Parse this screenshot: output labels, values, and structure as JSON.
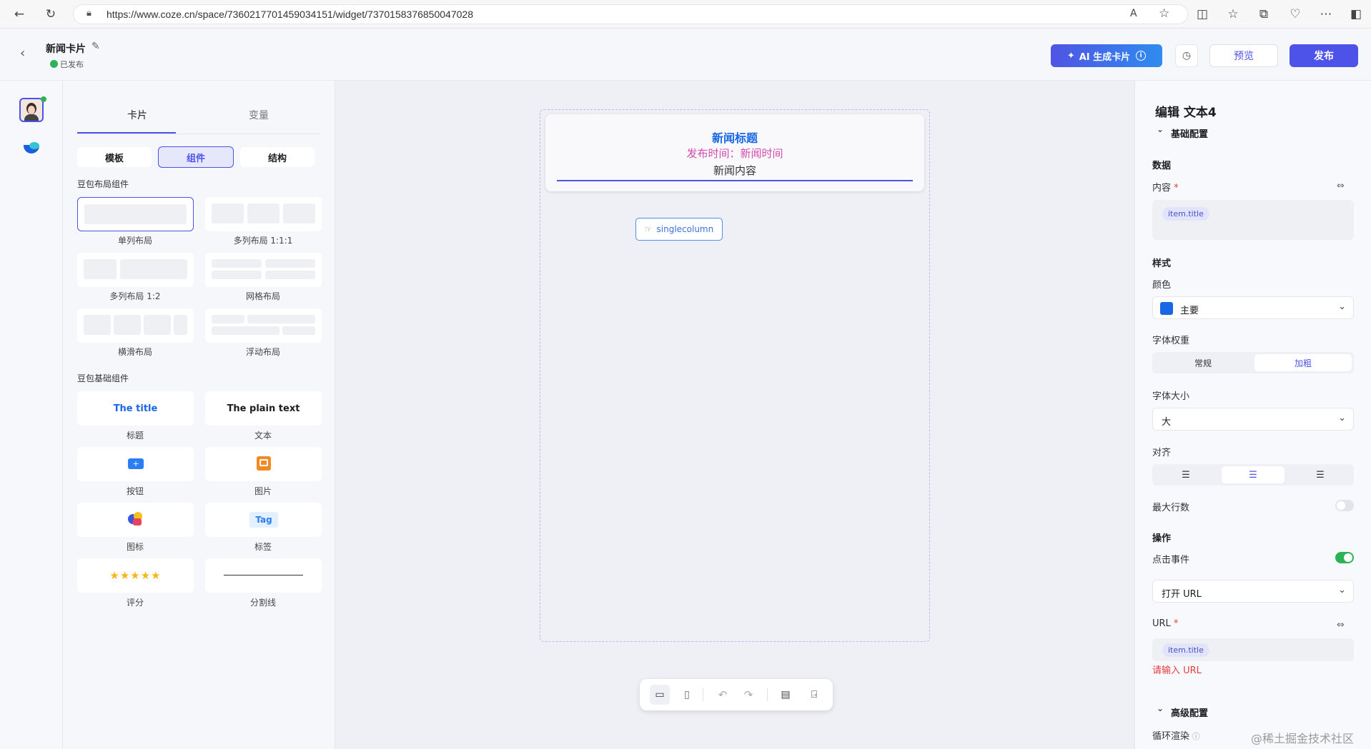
{
  "browser": {
    "url": "https://www.coze.cn/space/7360217701459034151/widget/7370158376850047028"
  },
  "header": {
    "title": "新闻卡片",
    "status": "已发布",
    "ai_button": "AI 生成卡片",
    "preview": "预览",
    "publish": "发布"
  },
  "panel": {
    "tabs": [
      "卡片",
      "变量"
    ],
    "subtabs": [
      "模板",
      "组件",
      "结构"
    ],
    "layout_section": "豆包布局组件",
    "layout_items": [
      "单列布局",
      "多列布局 1:1:1",
      "多列布局 1:2",
      "网格布局",
      "横滑布局",
      "浮动布局"
    ],
    "basic_section": "豆包基础组件",
    "basic_items": [
      "标题",
      "文本",
      "按钮",
      "图片",
      "图标",
      "标签",
      "评分",
      "分割线"
    ],
    "title_sample": "The title",
    "text_sample": "The plain text",
    "tag_sample": "Tag",
    "stars": "★★★★★"
  },
  "card": {
    "title": "新闻标题",
    "time": "发布时间：新闻时间",
    "content": "新闻内容",
    "singlecolumn": "singlecolumn"
  },
  "rpanel": {
    "heading": "编辑 文本4",
    "basic": "基础配置",
    "data": "数据",
    "content_label": "内容",
    "content_chip": "item.title",
    "style": "样式",
    "color_label": "颜色",
    "color_value": "主要",
    "weight_label": "字体权重",
    "weight_normal": "常规",
    "weight_bold": "加粗",
    "size_label": "字体大小",
    "size_value": "大",
    "align_label": "对齐",
    "maxlines": "最大行数",
    "ops": "操作",
    "click_event": "点击事件",
    "action": "打开 URL",
    "url_label": "URL",
    "url_chip": "item.title",
    "url_error": "请输入 URL",
    "advanced": "高级配置",
    "loop": "循环渲染"
  },
  "watermark": "@稀土掘金技术社区",
  "colors": {
    "accent": "#4d53e8",
    "primary_blue": "#1767e6",
    "time_pink": "#d44bb0",
    "toggle": "#2db357",
    "error": "#e33f3f"
  }
}
